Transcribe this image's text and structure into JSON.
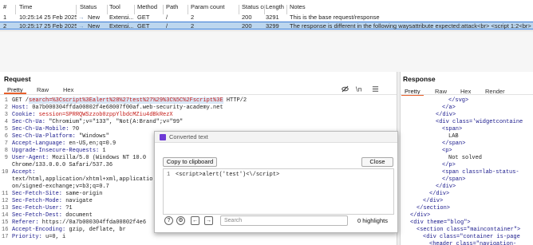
{
  "history": {
    "columns": [
      "#",
      "Time",
      "Status",
      "Tool",
      "Method",
      "Path",
      "Param count",
      "Status cc",
      "Length",
      "Notes"
    ],
    "rows": [
      {
        "num": "1",
        "time": "10:25:14 25 Feb 2025",
        "status": "New",
        "tool": "Extensi...",
        "method": "GET",
        "path": "/",
        "params": "2",
        "code": "200",
        "length": "3291",
        "notes": "This is the base request/response"
      },
      {
        "num": "2",
        "time": "10:25:17 25 Feb 2025",
        "status": "New",
        "tool": "Extensi...",
        "method": "GET",
        "path": "/",
        "params": "2",
        "code": "200",
        "length": "3299",
        "notes": "The response is different in the following waysattribute expected:attack<br> <script 1:2<br>"
      }
    ]
  },
  "request": {
    "title": "Request",
    "tabs": [
      "Pretty",
      "Raw",
      "Hex"
    ],
    "lines": [
      {
        "n": "1",
        "pre": "GET /",
        "query": "search=%3Cscript%3Ealert%28%27test%27%29%3C%5C%2Fscript%3E",
        "post": " HTTP/2"
      },
      {
        "n": "2",
        "name": "Host:",
        "value": " 0a7b000304ffda00802f4e68007f00af.web-security-academy.net"
      },
      {
        "n": "3",
        "name": "Cookie:",
        "value": " session=SPRRQWSzzob0zppYlbdcMZiu4dBkRezX"
      },
      {
        "n": "4",
        "name": "Sec-Ch-Ua:",
        "value": " \"Chromium\";v=\"133\", \"Not(A:Brand\";v=\"99\""
      },
      {
        "n": "5",
        "name": "Sec-Ch-Ua-Mobile:",
        "value": " ?0"
      },
      {
        "n": "6",
        "name": "Sec-Ch-Ua-Platform:",
        "value": " \"Windows\""
      },
      {
        "n": "7",
        "name": "Accept-Language:",
        "value": " en-US,en;q=0.9"
      },
      {
        "n": "8",
        "name": "Upgrade-Insecure-Requests:",
        "value": " 1"
      },
      {
        "n": "9",
        "name": "User-Agent:",
        "value": " Mozilla/5.0 (Windows NT 10.0"
      },
      {
        "n": "",
        "name": "",
        "value": "Chrome/133.0.0.0 Safari/537.36"
      },
      {
        "n": "10",
        "name": "Accept:",
        "value": ""
      },
      {
        "n": "",
        "name": "",
        "value": "text/html,application/xhtml+xml,applicatio"
      },
      {
        "n": "",
        "name": "",
        "value": "on/signed-exchange;v=b3;q=0.7"
      },
      {
        "n": "11",
        "name": "Sec-Fetch-Site:",
        "value": " same-origin"
      },
      {
        "n": "12",
        "name": "Sec-Fetch-Mode:",
        "value": " navigate"
      },
      {
        "n": "13",
        "name": "Sec-Fetch-User:",
        "value": " ?1"
      },
      {
        "n": "14",
        "name": "Sec-Fetch-Dest:",
        "value": " document"
      },
      {
        "n": "15",
        "name": "Referer:",
        "value": " https://0a7b000304ffda00802f4e6"
      },
      {
        "n": "16",
        "name": "Accept-Encoding:",
        "value": " gzip, deflate, br"
      },
      {
        "n": "17",
        "name": "Priority:",
        "value": " u=0, i"
      }
    ]
  },
  "response": {
    "title": "Response",
    "tabs": [
      "Pretty",
      "Raw",
      "Hex",
      "Render"
    ],
    "lines": [
      {
        "indent": 7,
        "text": "</svg>",
        "kind": "tag"
      },
      {
        "indent": 6,
        "text": "</a>",
        "kind": "tag"
      },
      {
        "indent": 5,
        "text": "</div>",
        "kind": "tag"
      },
      {
        "indent": 5,
        "text": "<div class='widgetcontaine",
        "kind": "tagattr"
      },
      {
        "indent": 6,
        "text": "<span>",
        "kind": "tag"
      },
      {
        "indent": 7,
        "text": "LAB",
        "kind": "text"
      },
      {
        "indent": 6,
        "text": "</span>",
        "kind": "tag"
      },
      {
        "indent": 6,
        "text": "<p>",
        "kind": "tag"
      },
      {
        "indent": 7,
        "text": "Not solved",
        "kind": "text"
      },
      {
        "indent": 6,
        "text": "</p>",
        "kind": "tag"
      },
      {
        "indent": 6,
        "text": "<span class=lab-status-",
        "kind": "tagattr"
      },
      {
        "indent": 6,
        "text": "</span>",
        "kind": "tag"
      },
      {
        "indent": 5,
        "text": "</div>",
        "kind": "tag"
      },
      {
        "indent": 4,
        "text": "</div>",
        "kind": "tag"
      },
      {
        "indent": 3,
        "text": "</div>",
        "kind": "tag"
      },
      {
        "indent": 2,
        "text": "</section>",
        "kind": "tag"
      },
      {
        "indent": 1,
        "text": "</div>",
        "kind": "tag"
      },
      {
        "indent": 1,
        "text": "<div theme=\"blog\">",
        "kind": "tagattr"
      },
      {
        "indent": 2,
        "text": "<section class=\"maincontainer\">",
        "kind": "tagattr"
      },
      {
        "indent": 3,
        "text": "<div class=\"container is-page",
        "kind": "tagattr"
      },
      {
        "indent": 4,
        "text": "<header class=\"navigation-",
        "kind": "tagattr"
      }
    ]
  },
  "dialog": {
    "title": "Converted text",
    "copy_label": "Copy to clipboard",
    "close_label": "Close",
    "line_number": "1",
    "converted": "<script>alert('test')<\\/script>",
    "search_placeholder": "Search",
    "highlights": "0 highlights"
  },
  "colors": {
    "accent": "#e8602c",
    "selected_row": "#bcd6ee",
    "dialog_icon": "#6e3ad6"
  }
}
